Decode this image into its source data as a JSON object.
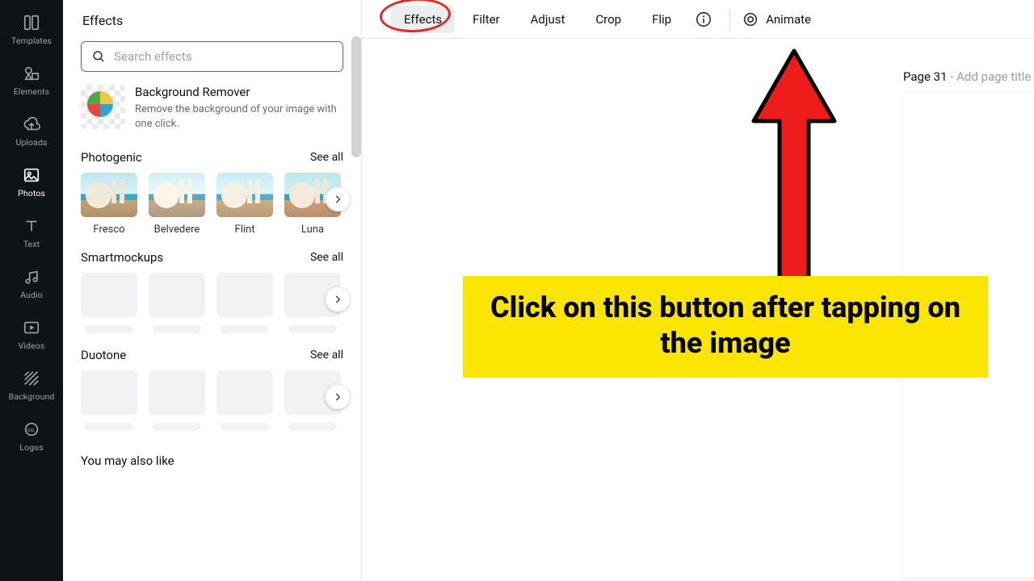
{
  "rail": [
    {
      "id": "templates",
      "label": "Templates"
    },
    {
      "id": "elements",
      "label": "Elements"
    },
    {
      "id": "uploads",
      "label": "Uploads"
    },
    {
      "id": "photos",
      "label": "Photos"
    },
    {
      "id": "text",
      "label": "Text"
    },
    {
      "id": "audio",
      "label": "Audio"
    },
    {
      "id": "videos",
      "label": "Videos"
    },
    {
      "id": "background",
      "label": "Background"
    },
    {
      "id": "logos",
      "label": "Logos"
    }
  ],
  "rail_active": "photos",
  "pane": {
    "title": "Effects",
    "search_placeholder": "Search effects",
    "bg_remover": {
      "title": "Background Remover",
      "desc": "Remove the background of your image with one click."
    },
    "sections": [
      {
        "title": "Photogenic",
        "see_all": "See all",
        "items": [
          "Fresco",
          "Belvedere",
          "Flint",
          "Luna"
        ]
      },
      {
        "title": "Smartmockups",
        "see_all": "See all",
        "placeholder": true
      },
      {
        "title": "Duotone",
        "see_all": "See all",
        "placeholder": true
      }
    ],
    "suggest": "You may also like"
  },
  "toolbar": {
    "tabs": [
      "Effects",
      "Filter",
      "Adjust",
      "Crop",
      "Flip"
    ],
    "active_tab": "Effects",
    "animate": "Animate"
  },
  "page": {
    "label_prefix": "Page 31",
    "label_sep": " - ",
    "label_placeholder": "Add page title"
  },
  "annotation": {
    "callout": "Click on this button after tapping on the image"
  }
}
